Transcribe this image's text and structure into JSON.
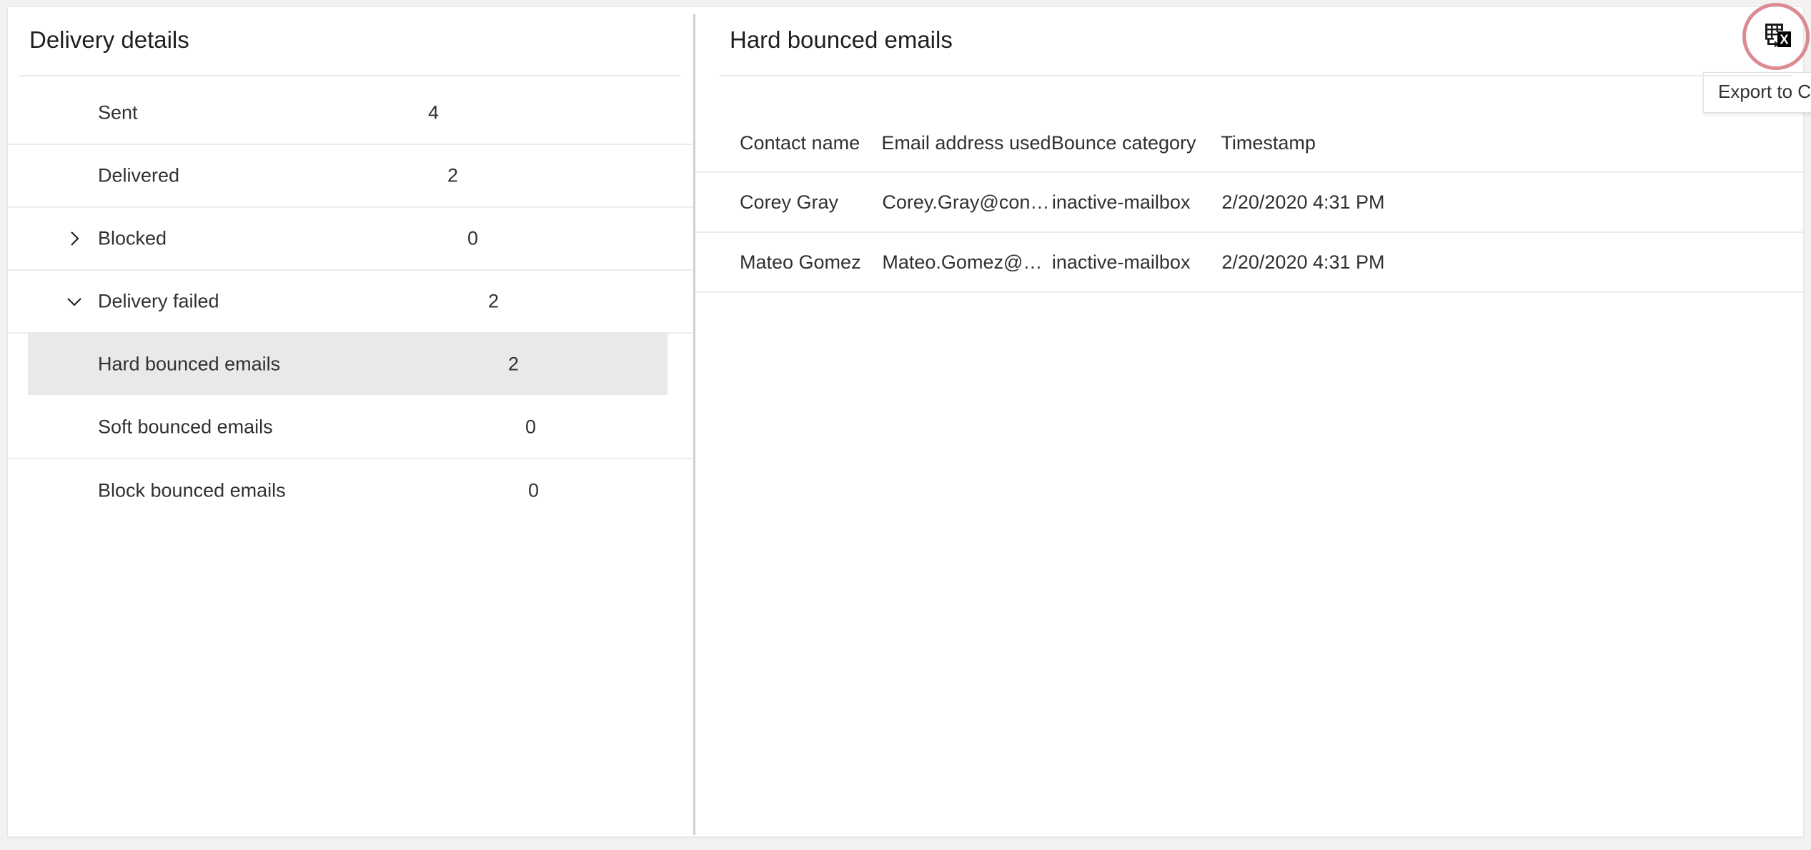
{
  "left_panel": {
    "title": "Delivery details",
    "rows": [
      {
        "label": "Sent",
        "value": "4",
        "level": 0,
        "chevron": "none",
        "selected": false
      },
      {
        "label": "Delivered",
        "value": "2",
        "level": 1,
        "chevron": "none",
        "selected": false
      },
      {
        "label": "Blocked",
        "value": "0",
        "level": 2,
        "chevron": "right",
        "selected": false
      },
      {
        "label": "Delivery failed",
        "value": "2",
        "level": 3,
        "chevron": "down",
        "selected": false
      },
      {
        "label": "Hard bounced emails",
        "value": "2",
        "level": 4,
        "chevron": "none",
        "selected": true
      },
      {
        "label": "Soft bounced emails",
        "value": "0",
        "level": 5,
        "chevron": "none",
        "selected": false
      },
      {
        "label": "Block bounced emails",
        "value": "0",
        "level": 6,
        "chevron": "none",
        "selected": false
      }
    ]
  },
  "right_panel": {
    "title": "Hard bounced emails",
    "export_button": {
      "icon": "export-to-excel-icon",
      "tooltip": "Export to CSV",
      "highlight_color": "#dc8a92"
    },
    "table": {
      "columns": [
        "Contact name",
        "Email address used",
        "Bounce category",
        "Timestamp"
      ],
      "rows": [
        {
          "contact_name": "Corey Gray",
          "email_address_used": "Corey.Gray@contos...",
          "bounce_category": "inactive-mailbox",
          "timestamp": "2/20/2020 4:31 PM"
        },
        {
          "contact_name": "Mateo Gomez",
          "email_address_used": "Mateo.Gomez@cont...",
          "bounce_category": "inactive-mailbox",
          "timestamp": "2/20/2020 4:31 PM"
        }
      ]
    }
  },
  "colors": {
    "page_background": "#f3f2f1",
    "card_background": "#ffffff",
    "divider": "#edebe9",
    "selected_row": "#ebe9e7",
    "text_primary": "#323130",
    "highlight_ring": "#dc8a92"
  }
}
